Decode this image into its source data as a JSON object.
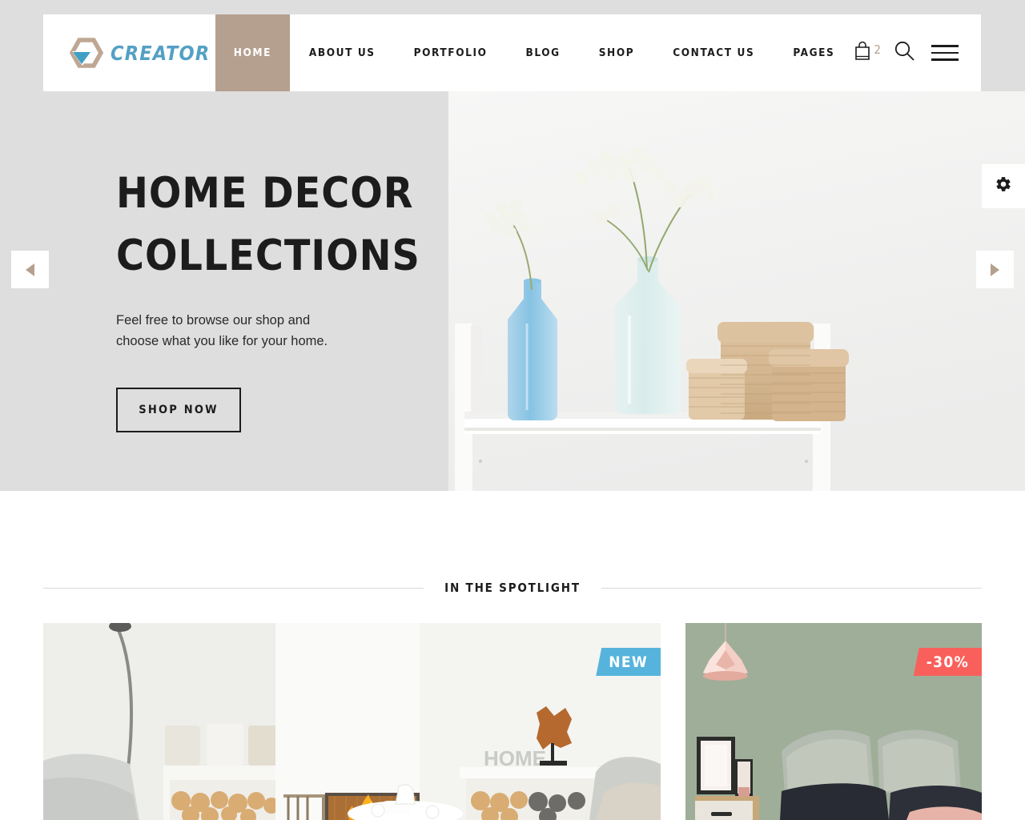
{
  "brand": {
    "name": "CREATOR",
    "logo_icon": "hexagon-arrow-logo",
    "accent_color": "#54a0c4",
    "tan_color": "#b5a08f"
  },
  "nav": {
    "items": [
      {
        "label": "HOME",
        "active": true
      },
      {
        "label": "ABOUT US",
        "active": false
      },
      {
        "label": "PORTFOLIO",
        "active": false
      },
      {
        "label": "BLOG",
        "active": false
      },
      {
        "label": "SHOP",
        "active": false
      },
      {
        "label": "CONTACT US",
        "active": false
      },
      {
        "label": "PAGES",
        "active": false
      }
    ]
  },
  "tools": {
    "cart_icon": "shopping-bag-icon",
    "cart_count": "2",
    "search_icon": "search-icon",
    "menu_icon": "hamburger-menu-icon"
  },
  "hero": {
    "title_line1": "HOME DECOR",
    "title_line2": "COLLECTIONS",
    "subtitle_line1": "Feel free to browse our shop and",
    "subtitle_line2": "choose what you like for your home.",
    "cta_label": "SHOP NOW",
    "prev_icon": "chevron-left-icon",
    "next_icon": "chevron-right-icon",
    "image_alt": "glass vases with baby's breath and woven baskets on a white shelf"
  },
  "settings": {
    "icon": "gear-icon"
  },
  "spotlight": {
    "section_title": "IN THE SPOTLIGHT",
    "cards": [
      {
        "badge": "NEW",
        "badge_color": "#56b4dc",
        "image_alt": "bright living room with fireplace, sofa and HOME decor letters"
      },
      {
        "badge": "-30%",
        "badge_color": "#f9605b",
        "image_alt": "green bedroom with pink origami pendant lamp and framed prints"
      }
    ]
  }
}
